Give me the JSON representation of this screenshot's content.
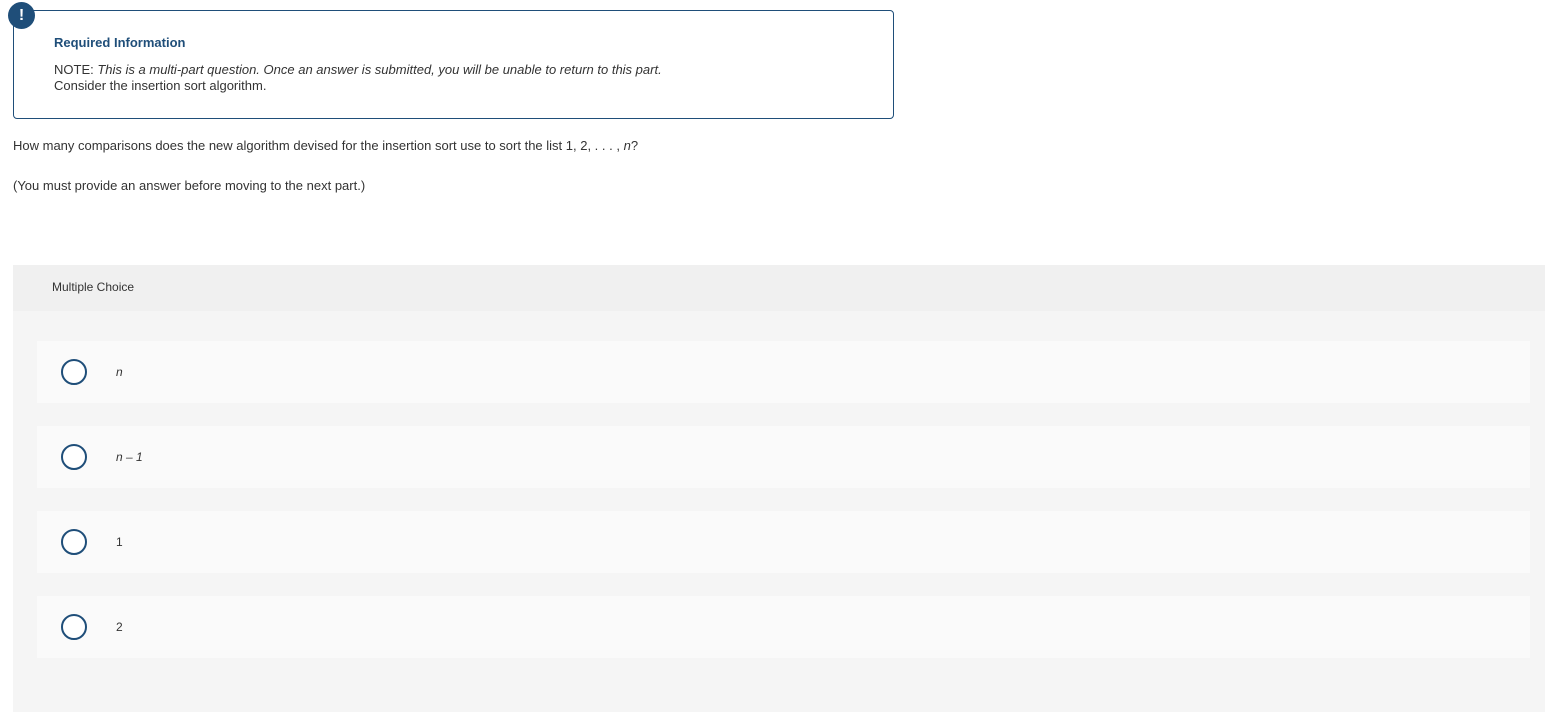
{
  "info": {
    "badge": "!",
    "title": "Required Information",
    "note_prefix": "NOTE:",
    "note_italic": "This is a multi-part question. Once an answer is submitted, you will be unable to return to this part.",
    "context": "Consider the insertion sort algorithm."
  },
  "question": {
    "text": "How many comparisons does the new algorithm devised for the insertion sort use to sort the list 1, 2, . . . ,",
    "variable": "n",
    "suffix": "?",
    "must_answer": "(You must provide an answer before moving to the next part.)"
  },
  "multiple_choice": {
    "header": "Multiple Choice",
    "options": [
      {
        "label": "n"
      },
      {
        "label": "n – 1"
      },
      {
        "label": "1"
      },
      {
        "label": "2"
      }
    ]
  },
  "colors": {
    "accent": "#1f4e79"
  }
}
